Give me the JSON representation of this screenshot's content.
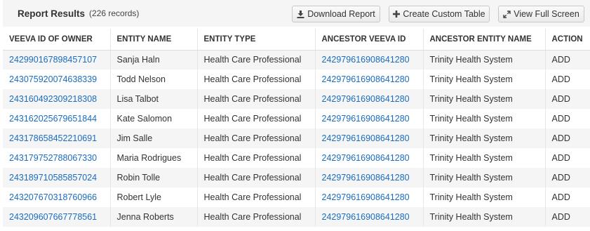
{
  "header": {
    "title": "Report Results",
    "count": "(226 records)",
    "buttons": {
      "download": "Download Report",
      "custom": "Create Custom Table",
      "full_screen": "View Full Screen"
    }
  },
  "table": {
    "columns": [
      "VEEVA ID OF OWNER",
      "ENTITY NAME",
      "ENTITY TYPE",
      "ANCESTOR VEEVA ID",
      "ANCESTOR ENTITY NAME",
      "ACTION"
    ],
    "rows": [
      [
        "242990167898457107",
        "Sanja Haln",
        "Health Care Professional",
        "242979616908641280",
        "Trinity Health System",
        "ADD"
      ],
      [
        "243075920074638339",
        "Todd Nelson",
        "Health Care Professional",
        "242979616908641280",
        "Trinity Health System",
        "ADD"
      ],
      [
        "243160492309218308",
        "Lisa Talbot",
        "Health Care Professional",
        "242979616908641280",
        "Trinity Health System",
        "ADD"
      ],
      [
        "243162025679651844",
        "Kate Salomon",
        "Health Care Professional",
        "242979616908641280",
        "Trinity Health System",
        "ADD"
      ],
      [
        "243178658452210691",
        "Jim Salle",
        "Health Care Professional",
        "242979616908641280",
        "Trinity Health System",
        "ADD"
      ],
      [
        "243179752788067330",
        "Maria Rodrigues",
        "Health Care Professional",
        "242979616908641280",
        "Trinity Health System",
        "ADD"
      ],
      [
        "243189710585857024",
        "Robin Tolle",
        "Health Care Professional",
        "242979616908641280",
        "Trinity Health System",
        "ADD"
      ],
      [
        "243207670318760966",
        "Robert Lyle",
        "Health Care Professional",
        "242979616908641280",
        "Trinity Health System",
        "ADD"
      ],
      [
        "243209607667778561",
        "Jenna Roberts",
        "Health Care Professional",
        "242979616908641280",
        "Trinity Health System",
        "ADD"
      ]
    ]
  },
  "colors": {
    "link": "#1a6cbf",
    "stripe": "#f5f5f5",
    "header_bg": "#f5f5f5"
  },
  "icons": {
    "download": "download-icon",
    "custom": "plus-icon",
    "full_screen": "expand-icon"
  }
}
